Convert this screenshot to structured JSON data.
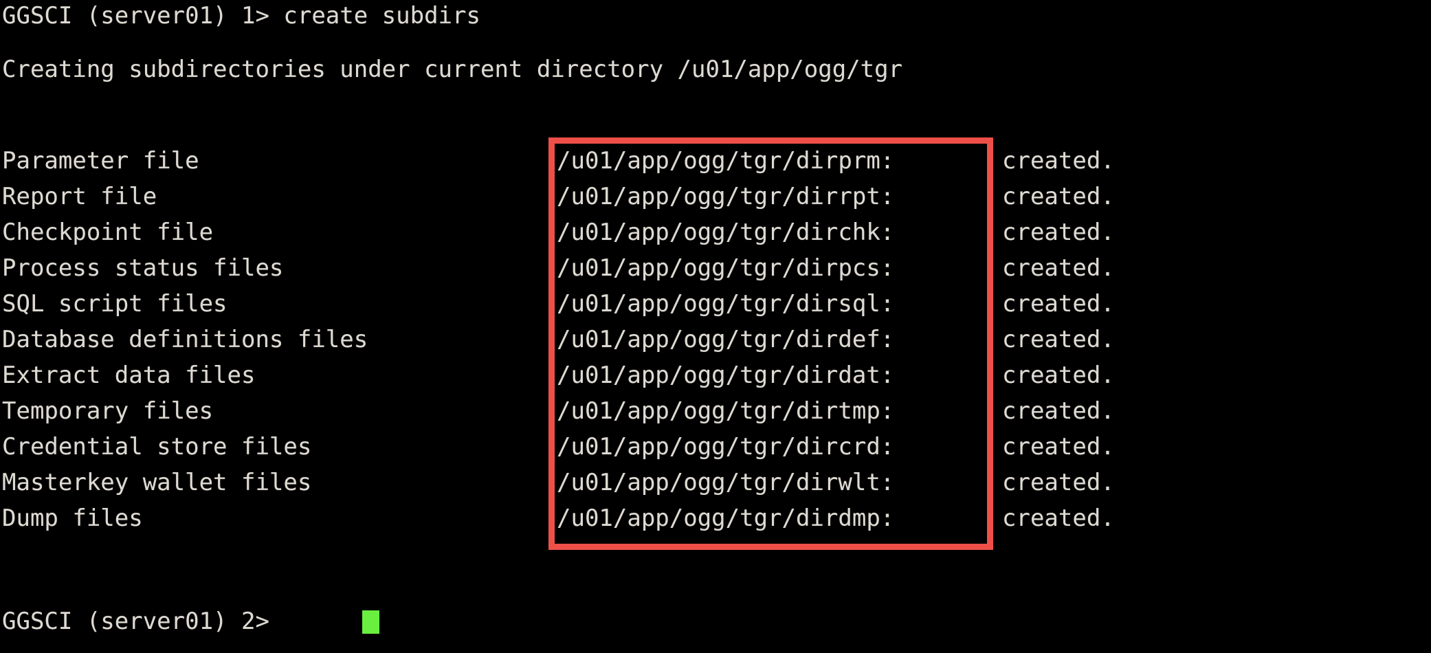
{
  "terminal": {
    "background_color": "#000000",
    "text_color": "#dedad2",
    "cursor_color": "#6aee40",
    "highlight_color": "#ee5049"
  },
  "command_line": {
    "prompt": "GGSCI (server01) 1> ",
    "command": "create subdirs",
    "full_text": "GGSCI (server01) 1> create subdirs"
  },
  "status_message": "Creating subdirectories under current directory /u01/app/ogg/tgr",
  "base_directory": "/u01/app/ogg/tgr",
  "subdirectory_table": {
    "rows": [
      {
        "label": "Parameter file",
        "path": "/u01/app/ogg/tgr/dirprm:",
        "status": "created."
      },
      {
        "label": "Report file",
        "path": "/u01/app/ogg/tgr/dirrpt:",
        "status": "created."
      },
      {
        "label": "Checkpoint file",
        "path": "/u01/app/ogg/tgr/dirchk:",
        "status": "created."
      },
      {
        "label": "Process status files",
        "path": "/u01/app/ogg/tgr/dirpcs:",
        "status": "created."
      },
      {
        "label": "SQL script files",
        "path": "/u01/app/ogg/tgr/dirsql:",
        "status": "created."
      },
      {
        "label": "Database definitions files",
        "path": "/u01/app/ogg/tgr/dirdef:",
        "status": "created."
      },
      {
        "label": "Extract data files",
        "path": "/u01/app/ogg/tgr/dirdat:",
        "status": "created."
      },
      {
        "label": "Temporary files",
        "path": "/u01/app/ogg/tgr/dirtmp:",
        "status": "created."
      },
      {
        "label": "Credential store files",
        "path": "/u01/app/ogg/tgr/dircrd:",
        "status": "created."
      },
      {
        "label": "Masterkey wallet files",
        "path": "/u01/app/ogg/tgr/dirwlt:",
        "status": "created."
      },
      {
        "label": "Dump files",
        "path": "/u01/app/ogg/tgr/dirdmp:",
        "status": "created."
      }
    ]
  },
  "next_prompt": {
    "text": "GGSCI (server01) 2> ",
    "cursor": "block"
  }
}
